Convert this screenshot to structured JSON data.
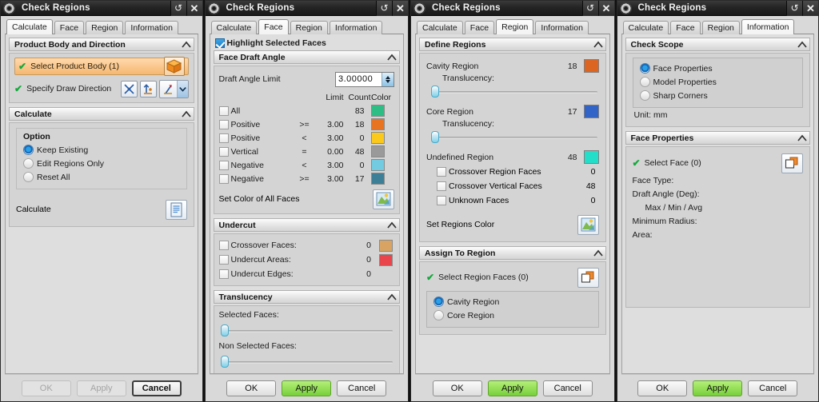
{
  "window": {
    "title": "Check Regions",
    "sysicon": "gear-icon",
    "restore_label": "↺",
    "close_label": "✕"
  },
  "tabs": [
    "Calculate",
    "Face",
    "Region",
    "Information"
  ],
  "buttons": {
    "ok": "OK",
    "apply": "Apply",
    "cancel": "Cancel"
  },
  "panel1": {
    "active_tab": "Calculate",
    "group_body_dir": "Product Body and Direction",
    "select_product_body": "Select Product Body (1)",
    "specify_draw_direction": "Specify Draw Direction",
    "group_calculate": "Calculate",
    "option_label": "Option",
    "options": [
      {
        "label": "Keep Existing",
        "selected": true
      },
      {
        "label": "Edit Regions Only",
        "selected": false
      },
      {
        "label": "Reset All",
        "selected": false
      }
    ],
    "calculate_action": "Calculate",
    "buttons_state": {
      "ok": "disabled",
      "apply": "disabled",
      "cancel": "focused"
    }
  },
  "panel2": {
    "active_tab": "Face",
    "highlight_selected_faces": {
      "label": "Highlight Selected Faces",
      "checked": true
    },
    "group_face_draft_angle": "Face Draft Angle",
    "draft_angle_limit_label": "Draft Angle Limit",
    "draft_angle_limit_value": "3.00000",
    "columns": [
      "Limit",
      "Count",
      "Color"
    ],
    "rows": [
      {
        "name": "All",
        "op": "",
        "limit": "",
        "count": "83",
        "color": "#2ebd85",
        "checked": false
      },
      {
        "name": "Positive",
        "op": ">=",
        "limit": "3.00",
        "count": "18",
        "color": "#e87422",
        "checked": false
      },
      {
        "name": "Positive",
        "op": "<",
        "limit": "3.00",
        "count": "0",
        "color": "#fbc91c",
        "checked": false
      },
      {
        "name": "Vertical",
        "op": "=",
        "limit": "0.00",
        "count": "48",
        "color": "#9a9a9a",
        "checked": false
      },
      {
        "name": "Negative",
        "op": "<",
        "limit": "3.00",
        "count": "0",
        "color": "#72cbe0",
        "checked": false
      },
      {
        "name": "Negative",
        "op": ">=",
        "limit": "3.00",
        "count": "17",
        "color": "#3d7f96",
        "checked": false
      }
    ],
    "set_color_of_all_faces": "Set Color of All Faces",
    "group_undercut": "Undercut",
    "undercut": [
      {
        "label": "Crossover Faces:",
        "count": "0",
        "color": "#d9a463",
        "checked": false
      },
      {
        "label": "Undercut Areas:",
        "count": "0",
        "color": "#e8454c",
        "checked": false
      },
      {
        "label": "Undercut Edges:",
        "count": "0",
        "color": "",
        "checked": false
      }
    ],
    "group_translucency": "Translucency",
    "translucency": [
      {
        "label": "Selected Faces:",
        "value": 0
      },
      {
        "label": "Non Selected Faces:",
        "value": 0
      }
    ],
    "buttons_state": {
      "ok": "normal",
      "apply": "green",
      "cancel": "normal"
    }
  },
  "panel3": {
    "active_tab": "Region",
    "group_define_regions": "Define Regions",
    "regions": [
      {
        "name": "Cavity Region",
        "count": "18",
        "color": "#dd6522",
        "translucency_label": "Translucency:",
        "translucency": 0
      },
      {
        "name": "Core Region",
        "count": "17",
        "color": "#3264c8",
        "translucency_label": "Translucency:",
        "translucency": 0
      }
    ],
    "undefined_region": {
      "name": "Undefined Region",
      "count": "48",
      "color": "#23dfc9"
    },
    "undefined_children": [
      {
        "label": "Crossover Region Faces",
        "count": "0",
        "checked": false
      },
      {
        "label": "Crossover Vertical Faces",
        "count": "48",
        "checked": false
      },
      {
        "label": "Unknown Faces",
        "count": "0",
        "checked": false
      }
    ],
    "set_regions_color": "Set Regions Color",
    "group_assign_to_region": "Assign To Region",
    "select_region_faces": "Select Region Faces (0)",
    "assign_options": [
      {
        "label": "Cavity Region",
        "selected": true
      },
      {
        "label": "Core Region",
        "selected": false
      }
    ],
    "buttons_state": {
      "ok": "normal",
      "apply": "green",
      "cancel": "normal"
    }
  },
  "panel4": {
    "active_tab": "Information",
    "group_check_scope": "Check Scope",
    "scope_options": [
      {
        "label": "Face Properties",
        "selected": true
      },
      {
        "label": "Model Properties",
        "selected": false
      },
      {
        "label": "Sharp Corners",
        "selected": false
      }
    ],
    "unit_line": "Unit: mm",
    "group_face_properties": "Face Properties",
    "select_face": "Select Face (0)",
    "props": [
      {
        "label": "Face Type:",
        "indent": false
      },
      {
        "label": "Draft Angle (Deg):",
        "indent": false
      },
      {
        "label": "Max / Min / Avg",
        "indent": true
      },
      {
        "label": "Minimum Radius:",
        "indent": false
      },
      {
        "label": "Area:",
        "indent": false
      }
    ],
    "buttons_state": {
      "ok": "normal",
      "apply": "green",
      "cancel": "normal"
    }
  }
}
